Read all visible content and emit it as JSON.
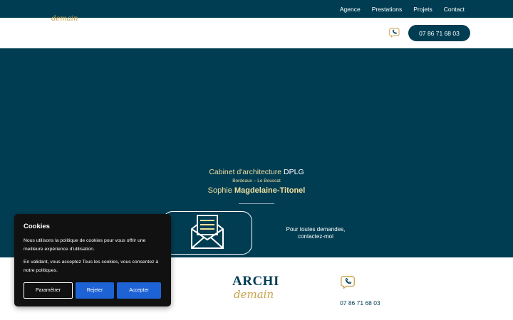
{
  "nav": {
    "items": [
      {
        "label": "Agence"
      },
      {
        "label": "Prestations"
      },
      {
        "label": "Projets"
      },
      {
        "label": "Contact"
      }
    ]
  },
  "brand": {
    "name": "ARCHI",
    "script": "demain",
    "color_primary": "#003d52",
    "color_gold": "#c8a24a"
  },
  "header": {
    "phone_icon": "phone-icon",
    "phone_label": "07 86 71 68 03"
  },
  "hero": {
    "line1_a": "Cabinet d'architecture",
    "line1_b": " DPLG",
    "line2": "Bordeaux – Le Bouscat",
    "line3_a": "Sophie ",
    "line3_b": "Magdelaine-Titonel",
    "mail_icon": "envelope-letter-icon",
    "contact_line1": "Pour toutes demandes,",
    "contact_line2": "contactez-moi"
  },
  "footer": {
    "phone_icon": "phone-icon",
    "phone": "07 86 71 68 03"
  },
  "cookie": {
    "title": "Cookies",
    "text1": "Nous utilisons la politique de cookies pour vous offrir une meilleure expérience d'utilisation.",
    "text2": "En validant, vous acceptez Tous les cookies, vous consentez à notre politiques.",
    "btn_settings": "Paramétrer",
    "btn_reject": "Rejeter",
    "btn_accept": "Accepter",
    "accent": "#1e63d6"
  }
}
